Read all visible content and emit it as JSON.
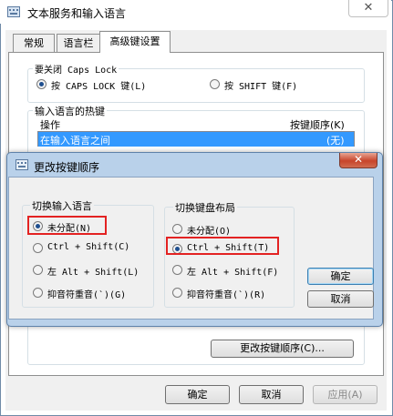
{
  "window": {
    "title": "文本服务和输入语言",
    "close_glyph": "✕"
  },
  "tabs": [
    {
      "label": "常规"
    },
    {
      "label": "语言栏"
    },
    {
      "label": "高级键设置"
    }
  ],
  "caps_lock": {
    "group_label": "要关闭 Caps Lock",
    "option_caps": "按 CAPS LOCK 键(L)",
    "option_shift": "按 SHIFT 键(F)",
    "selected": "caps"
  },
  "hotkeys": {
    "group_label": "输入语言的热键",
    "col_action": "操作",
    "col_sequence": "按键顺序(K)",
    "row_selected_action": "在输入语言之间",
    "row_selected_sequence": "(无)",
    "change_button": "更改按键顺序(C)..."
  },
  "footer": {
    "ok": "确定",
    "cancel": "取消",
    "apply": "应用(A)"
  },
  "dialog": {
    "title": "更改按键顺序",
    "close_glyph": "✕",
    "switch_language": {
      "label": "切换输入语言",
      "options": [
        "未分配(N)",
        "Ctrl + Shift(C)",
        "左 Alt + Shift(L)",
        "抑音符重音(`)(G)"
      ],
      "selected_index": 0
    },
    "switch_layout": {
      "label": "切换键盘布局",
      "options": [
        "未分配(O)",
        "Ctrl + Shift(T)",
        "左 Alt + Shift(F)",
        "抑音符重音(`)(R)"
      ],
      "selected_index": 1
    },
    "ok": "确定",
    "cancel": "取消"
  },
  "colors": {
    "selection": "#3399ff",
    "highlight_box": "#e32222",
    "dialog_frame": "#b9d1ea",
    "close_button": "#c7442a"
  }
}
